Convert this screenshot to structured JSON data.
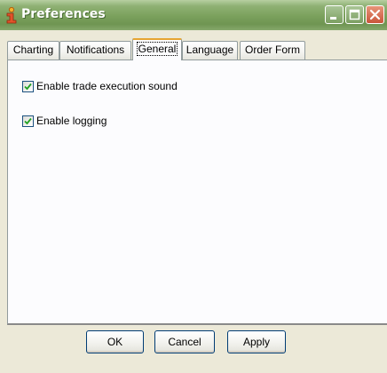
{
  "window": {
    "title": "Preferences",
    "app_icon": "info-i-icon",
    "controls": {
      "minimize_icon": "minimize-icon",
      "maximize_icon": "maximize-icon",
      "close_icon": "close-icon"
    }
  },
  "tabs": [
    {
      "label": "Charting"
    },
    {
      "label": "Notifications"
    },
    {
      "label": "General"
    },
    {
      "label": "Language"
    },
    {
      "label": "Order Form"
    }
  ],
  "active_tab": "General",
  "general": {
    "options": [
      {
        "label": "Enable trade execution sound",
        "checked": true
      },
      {
        "label": "Enable logging",
        "checked": true
      }
    ]
  },
  "buttons": {
    "ok": "OK",
    "cancel": "Cancel",
    "apply": "Apply"
  },
  "colors": {
    "titlebar": "#7aa05c",
    "active_tab_accent": "#e6a531",
    "close_button": "#c9553a",
    "check_mark": "#21a121"
  }
}
